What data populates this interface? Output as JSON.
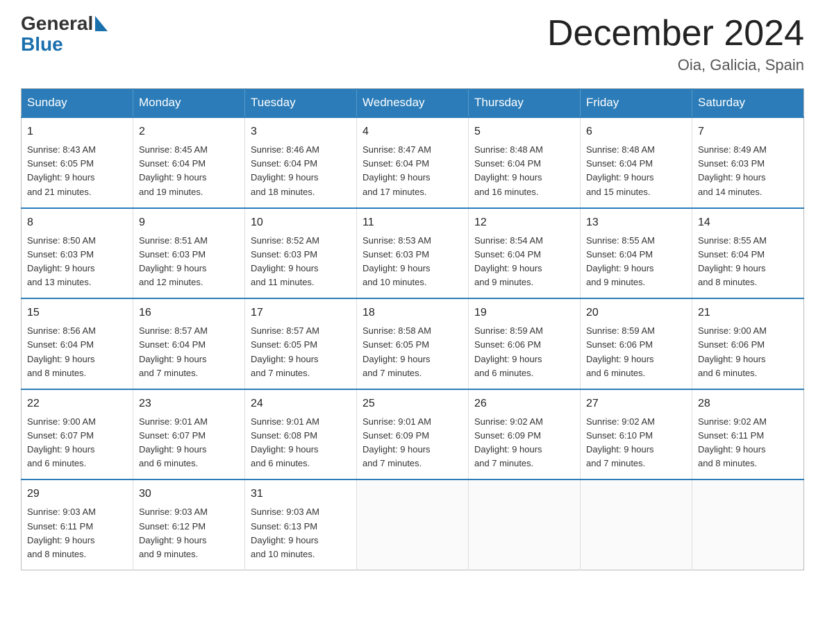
{
  "header": {
    "logo_general": "General",
    "logo_blue": "Blue",
    "month_title": "December 2024",
    "location": "Oia, Galicia, Spain"
  },
  "days_of_week": [
    "Sunday",
    "Monday",
    "Tuesday",
    "Wednesday",
    "Thursday",
    "Friday",
    "Saturday"
  ],
  "weeks": [
    [
      {
        "day": "1",
        "sunrise": "8:43 AM",
        "sunset": "6:05 PM",
        "daylight": "9 hours and 21 minutes."
      },
      {
        "day": "2",
        "sunrise": "8:45 AM",
        "sunset": "6:04 PM",
        "daylight": "9 hours and 19 minutes."
      },
      {
        "day": "3",
        "sunrise": "8:46 AM",
        "sunset": "6:04 PM",
        "daylight": "9 hours and 18 minutes."
      },
      {
        "day": "4",
        "sunrise": "8:47 AM",
        "sunset": "6:04 PM",
        "daylight": "9 hours and 17 minutes."
      },
      {
        "day": "5",
        "sunrise": "8:48 AM",
        "sunset": "6:04 PM",
        "daylight": "9 hours and 16 minutes."
      },
      {
        "day": "6",
        "sunrise": "8:48 AM",
        "sunset": "6:04 PM",
        "daylight": "9 hours and 15 minutes."
      },
      {
        "day": "7",
        "sunrise": "8:49 AM",
        "sunset": "6:03 PM",
        "daylight": "9 hours and 14 minutes."
      }
    ],
    [
      {
        "day": "8",
        "sunrise": "8:50 AM",
        "sunset": "6:03 PM",
        "daylight": "9 hours and 13 minutes."
      },
      {
        "day": "9",
        "sunrise": "8:51 AM",
        "sunset": "6:03 PM",
        "daylight": "9 hours and 12 minutes."
      },
      {
        "day": "10",
        "sunrise": "8:52 AM",
        "sunset": "6:03 PM",
        "daylight": "9 hours and 11 minutes."
      },
      {
        "day": "11",
        "sunrise": "8:53 AM",
        "sunset": "6:03 PM",
        "daylight": "9 hours and 10 minutes."
      },
      {
        "day": "12",
        "sunrise": "8:54 AM",
        "sunset": "6:04 PM",
        "daylight": "9 hours and 9 minutes."
      },
      {
        "day": "13",
        "sunrise": "8:55 AM",
        "sunset": "6:04 PM",
        "daylight": "9 hours and 9 minutes."
      },
      {
        "day": "14",
        "sunrise": "8:55 AM",
        "sunset": "6:04 PM",
        "daylight": "9 hours and 8 minutes."
      }
    ],
    [
      {
        "day": "15",
        "sunrise": "8:56 AM",
        "sunset": "6:04 PM",
        "daylight": "9 hours and 8 minutes."
      },
      {
        "day": "16",
        "sunrise": "8:57 AM",
        "sunset": "6:04 PM",
        "daylight": "9 hours and 7 minutes."
      },
      {
        "day": "17",
        "sunrise": "8:57 AM",
        "sunset": "6:05 PM",
        "daylight": "9 hours and 7 minutes."
      },
      {
        "day": "18",
        "sunrise": "8:58 AM",
        "sunset": "6:05 PM",
        "daylight": "9 hours and 7 minutes."
      },
      {
        "day": "19",
        "sunrise": "8:59 AM",
        "sunset": "6:06 PM",
        "daylight": "9 hours and 6 minutes."
      },
      {
        "day": "20",
        "sunrise": "8:59 AM",
        "sunset": "6:06 PM",
        "daylight": "9 hours and 6 minutes."
      },
      {
        "day": "21",
        "sunrise": "9:00 AM",
        "sunset": "6:06 PM",
        "daylight": "9 hours and 6 minutes."
      }
    ],
    [
      {
        "day": "22",
        "sunrise": "9:00 AM",
        "sunset": "6:07 PM",
        "daylight": "9 hours and 6 minutes."
      },
      {
        "day": "23",
        "sunrise": "9:01 AM",
        "sunset": "6:07 PM",
        "daylight": "9 hours and 6 minutes."
      },
      {
        "day": "24",
        "sunrise": "9:01 AM",
        "sunset": "6:08 PM",
        "daylight": "9 hours and 6 minutes."
      },
      {
        "day": "25",
        "sunrise": "9:01 AM",
        "sunset": "6:09 PM",
        "daylight": "9 hours and 7 minutes."
      },
      {
        "day": "26",
        "sunrise": "9:02 AM",
        "sunset": "6:09 PM",
        "daylight": "9 hours and 7 minutes."
      },
      {
        "day": "27",
        "sunrise": "9:02 AM",
        "sunset": "6:10 PM",
        "daylight": "9 hours and 7 minutes."
      },
      {
        "day": "28",
        "sunrise": "9:02 AM",
        "sunset": "6:11 PM",
        "daylight": "9 hours and 8 minutes."
      }
    ],
    [
      {
        "day": "29",
        "sunrise": "9:03 AM",
        "sunset": "6:11 PM",
        "daylight": "9 hours and 8 minutes."
      },
      {
        "day": "30",
        "sunrise": "9:03 AM",
        "sunset": "6:12 PM",
        "daylight": "9 hours and 9 minutes."
      },
      {
        "day": "31",
        "sunrise": "9:03 AM",
        "sunset": "6:13 PM",
        "daylight": "9 hours and 10 minutes."
      },
      null,
      null,
      null,
      null
    ]
  ],
  "labels": {
    "sunrise": "Sunrise:",
    "sunset": "Sunset:",
    "daylight": "Daylight:"
  }
}
